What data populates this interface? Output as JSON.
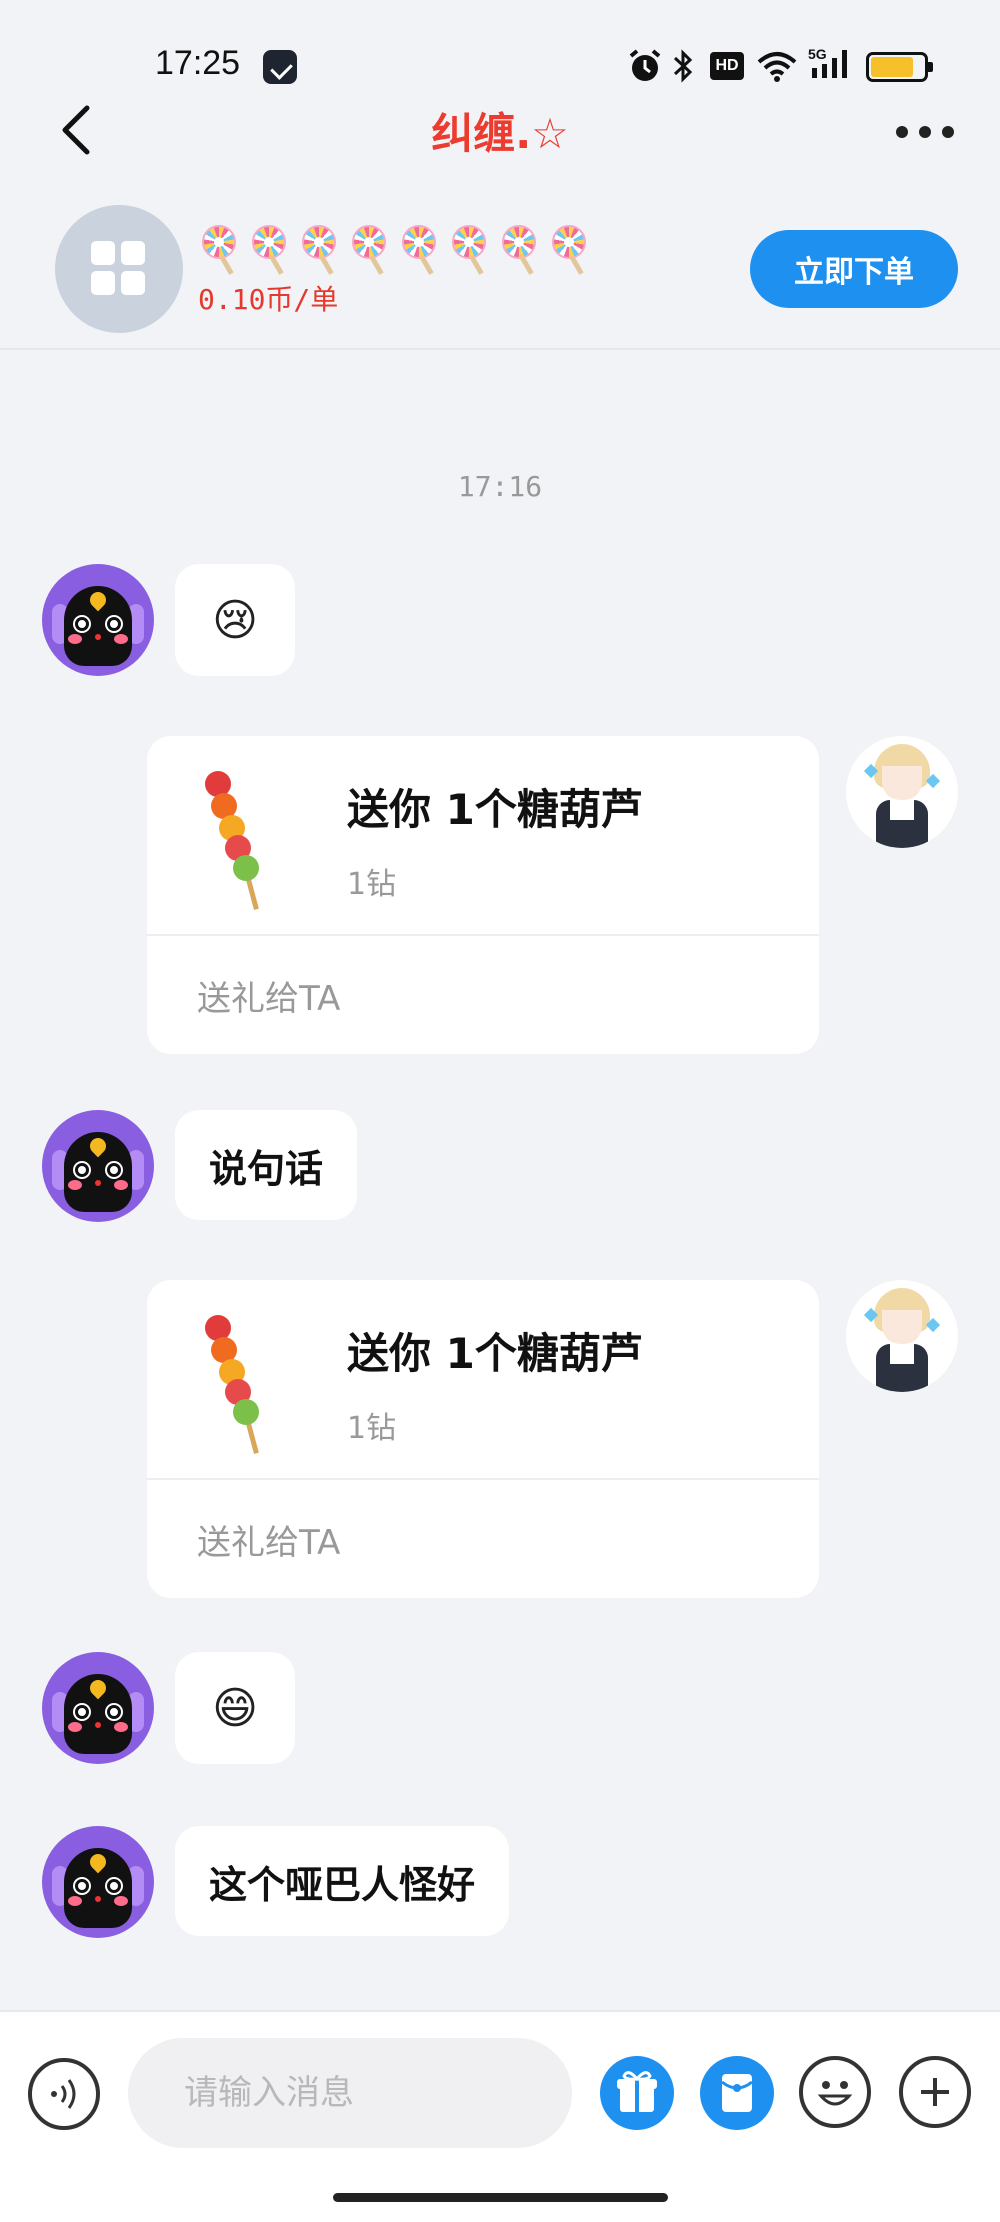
{
  "status_bar": {
    "time": "17:25",
    "icons": [
      "app-notification-icon",
      "alarm-icon",
      "bluetooth-icon",
      "hd-icon",
      "wifi-icon",
      "5g-signal-icon",
      "battery-icon"
    ],
    "hd_label": "HD",
    "network_label": "5G"
  },
  "nav": {
    "title": "纠缠.☆",
    "back_icon": "back-arrow-icon",
    "more_icon": "more-dots-icon"
  },
  "service": {
    "badges_count": 8,
    "price": "0.10币/单",
    "order_label": "立即下单",
    "accent": "#1e90f0",
    "price_color": "#e5392d"
  },
  "chat": {
    "time_stamp": "17:16",
    "messages": [
      {
        "side": "left",
        "type": "emoji",
        "content": "😢"
      },
      {
        "side": "right",
        "type": "gift",
        "title": "送你 1个糖葫芦",
        "price": "1钻",
        "action": "送礼给TA"
      },
      {
        "side": "left",
        "type": "text",
        "content": "说句话"
      },
      {
        "side": "right",
        "type": "gift",
        "title": "送你 1个糖葫芦",
        "price": "1钻",
        "action": "送礼给TA"
      },
      {
        "side": "left",
        "type": "emoji",
        "content": "😄"
      },
      {
        "side": "left",
        "type": "text",
        "content": "这个哑巴人怪好"
      }
    ]
  },
  "input": {
    "placeholder": "请输入消息",
    "icons": [
      "voice-icon",
      "gift-icon",
      "red-packet-icon",
      "emoji-icon",
      "plus-icon"
    ]
  }
}
